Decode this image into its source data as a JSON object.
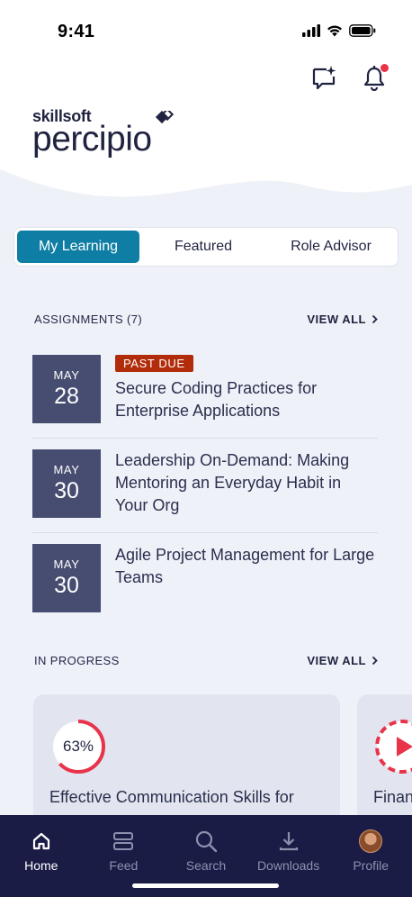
{
  "status_bar": {
    "time": "9:41"
  },
  "logo": {
    "brand_small": "skillsoft",
    "brand_big": "percipio"
  },
  "tabs": [
    {
      "label": "My Learning",
      "active": true
    },
    {
      "label": "Featured",
      "active": false
    },
    {
      "label": "Role Advisor",
      "active": false
    }
  ],
  "assignments": {
    "title": "ASSIGNMENTS (7)",
    "view_all": "VIEW ALL",
    "items": [
      {
        "month": "MAY",
        "day": "28",
        "badge": "PAST DUE",
        "title": "Secure Coding Practices for Enterprise Applications"
      },
      {
        "month": "MAY",
        "day": "30",
        "badge": "",
        "title": "Leadership On-Demand: Making Mentoring an Everyday Habit in Your Org"
      },
      {
        "month": "MAY",
        "day": "30",
        "badge": "",
        "title": "Agile Project Management for Large Teams"
      }
    ]
  },
  "in_progress": {
    "title": "IN PROGRESS",
    "view_all": "VIEW ALL",
    "cards": [
      {
        "progress_label": "63%",
        "progress": 0.63,
        "title": "Effective Communication Skills for"
      },
      {
        "title": "Finan"
      }
    ]
  },
  "bottom_nav": [
    {
      "label": "Home",
      "icon": "home-icon",
      "active": true
    },
    {
      "label": "Feed",
      "icon": "feed-icon",
      "active": false
    },
    {
      "label": "Search",
      "icon": "search-icon",
      "active": false
    },
    {
      "label": "Downloads",
      "icon": "download-icon",
      "active": false
    },
    {
      "label": "Profile",
      "icon": "avatar",
      "active": false
    }
  ],
  "colors": {
    "accent": "#0f7ea4",
    "nav_bg": "#1b1c46",
    "badge": "#b12c0a",
    "progress": "#e8334a",
    "date_box": "#464d70"
  }
}
